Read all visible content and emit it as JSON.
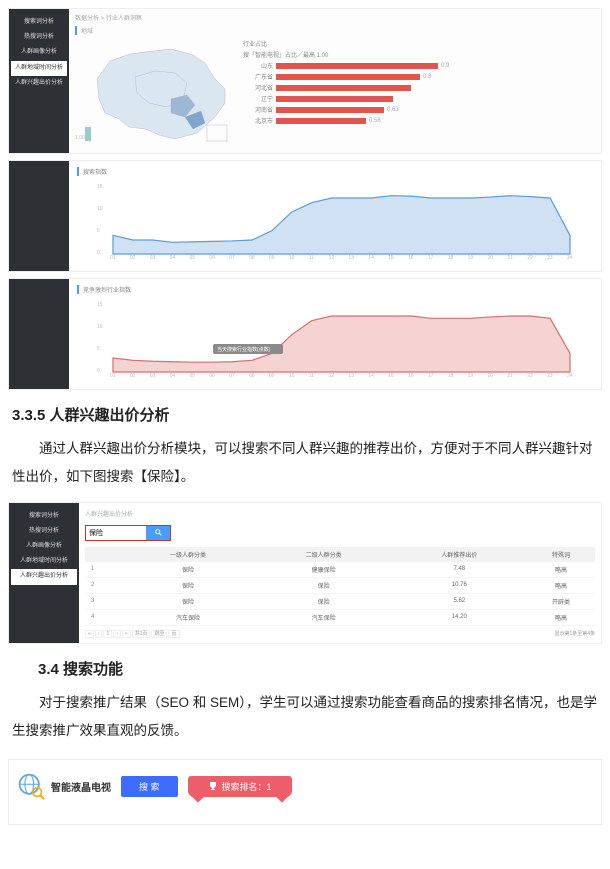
{
  "sidebar": {
    "items": [
      "搜索词分析",
      "热搜词分析",
      "人群画像分析",
      "人群地域时间分析",
      "人群兴趣出价分析"
    ],
    "active_index": 3
  },
  "breadcrumb_top": "数据分析 > 行业人群洞察",
  "map_panel": {
    "tab": "地域",
    "title": "行业占比",
    "subtitle": "搜「智能电视」占比／最高 1.00",
    "regions": [
      {
        "label": "山东",
        "value": 0.9,
        "text": "0.9"
      },
      {
        "label": "广东省",
        "value": 0.8,
        "text": "0.8"
      },
      {
        "label": "河北省",
        "value": 0.75,
        "text": ""
      },
      {
        "label": "辽宁",
        "value": 0.65,
        "text": ""
      },
      {
        "label": "河南省",
        "value": 0.6,
        "text": "0.63"
      },
      {
        "label": "北京市",
        "value": 0.5,
        "text": "0.58"
      }
    ]
  },
  "chart_blue_title": "搜索指数",
  "chart_red_title": "竞争激烈行业指数",
  "chart_tooltip": "当天搜索行业指数(点数)",
  "chart_data": [
    {
      "type": "area",
      "title": "搜索指数",
      "ylim": [
        0,
        15
      ],
      "yticks": [
        0,
        5,
        10,
        15
      ],
      "x_labels": [
        "01",
        "02",
        "03",
        "04",
        "05",
        "06",
        "07",
        "08",
        "09",
        "10",
        "11",
        "12",
        "13",
        "14",
        "15",
        "16",
        "17",
        "18",
        "19",
        "20",
        "21",
        "22",
        "23",
        "24"
      ],
      "values": [
        4,
        3,
        3,
        2.5,
        2.6,
        2.7,
        2.8,
        3,
        5,
        9,
        11,
        12,
        12,
        12,
        12.5,
        12.4,
        12,
        12,
        12,
        12.2,
        12.5,
        12.3,
        12,
        4
      ]
    },
    {
      "type": "area",
      "title": "竞争激烈行业指数",
      "ylim": [
        0,
        15
      ],
      "yticks": [
        0,
        5,
        10,
        15
      ],
      "x_labels": [
        "01",
        "02",
        "03",
        "04",
        "05",
        "06",
        "07",
        "08",
        "09",
        "10",
        "11",
        "12",
        "13",
        "14",
        "15",
        "16",
        "17",
        "18",
        "19",
        "20",
        "21",
        "22",
        "23",
        "24"
      ],
      "values": [
        3,
        2.5,
        2.3,
        2.2,
        2.1,
        2.1,
        2.2,
        2.5,
        4,
        8,
        11,
        12,
        12,
        12,
        12,
        12,
        11.5,
        11.5,
        11.5,
        11.8,
        12,
        12,
        11.5,
        4
      ]
    }
  ],
  "heading_335": "3.3.5 人群兴趣出价分析",
  "para_335": "通过人群兴趣出价分析模块，可以搜索不同人群兴趣的推荐出价，方便对于不同人群兴趣针对性出价，如下图搜索【保险】。",
  "bid_panel": {
    "breadcrumb": "人群兴趣出价分析",
    "search_value": "保险",
    "columns": [
      "",
      "一级人群分类",
      "二级人群分类",
      "人群推荐出价",
      "特殊词"
    ],
    "rows": [
      [
        "1",
        "保险",
        "健康保险",
        "7.48",
        "略高"
      ],
      [
        "2",
        "保险",
        "保险",
        "10.76",
        "略高"
      ],
      [
        "3",
        "保险",
        "保险",
        "5.62",
        "开辟类"
      ],
      [
        "4",
        "汽车保险",
        "汽车保险",
        "14.20",
        "略高"
      ]
    ],
    "pager_left": [
      "«",
      "‹",
      "1",
      "›",
      "»",
      "共1页",
      "跳至",
      "页"
    ],
    "pager_right": "显示第1条至第4条"
  },
  "heading_34": "3.4  搜索功能",
  "para_34": "对于搜索推广结果（SEO 和 SEM），学生可以通过搜索功能查看商品的搜索排名情况，也是学生搜索推广效果直观的反馈。",
  "search_bar": {
    "logo_text": "智能液晶电视",
    "button": "搜 索",
    "rank_label": "搜索排名：1"
  }
}
